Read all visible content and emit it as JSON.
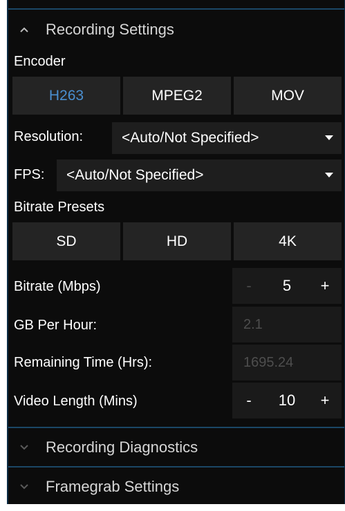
{
  "recording_settings": {
    "title": "Recording Settings",
    "encoder_label": "Encoder",
    "encoders": [
      {
        "label": "H263",
        "selected": true
      },
      {
        "label": "MPEG2",
        "selected": false
      },
      {
        "label": "MOV",
        "selected": false
      }
    ],
    "resolution_label": "Resolution:",
    "resolution_value": "<Auto/Not Specified>",
    "fps_label": "FPS:",
    "fps_value": "<Auto/Not Specified>",
    "bitrate_presets_label": "Bitrate Presets",
    "bitrate_presets": [
      "SD",
      "HD",
      "4K"
    ],
    "bitrate_label": "Bitrate (Mbps)",
    "bitrate_value": "5",
    "gb_per_hour_label": "GB Per Hour:",
    "gb_per_hour_value": "2.1",
    "remaining_time_label": "Remaining Time (Hrs):",
    "remaining_time_value": "1695.24",
    "video_length_label": "Video Length (Mins)",
    "video_length_value": "10",
    "minus": "-",
    "plus": "+"
  },
  "sections": {
    "diagnostics": "Recording Diagnostics",
    "framegrab": "Framegrab Settings"
  },
  "colors": {
    "selected_text": "#4a8fd0",
    "panel_bg": "#0c0c0c",
    "border": "#1b4766"
  }
}
